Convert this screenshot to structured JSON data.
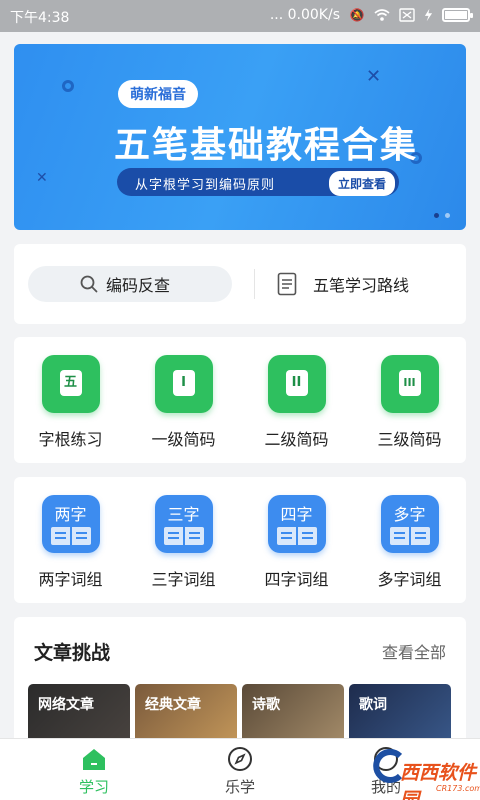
{
  "status_bar": {
    "time": "下午4:38",
    "network_speed": "... 0.00K/s",
    "icons": [
      "mute-icon",
      "wifi-icon",
      "sim-off-icon",
      "charging-icon"
    ],
    "battery_level": 1.0
  },
  "banner": {
    "brand": "萌新福音",
    "title": "五笔基础教程合集",
    "subtitle": "从字根学习到编码原则",
    "cta": "立即查看",
    "page_count": 2,
    "active_page": 1
  },
  "search": {
    "lookup_label": "编码反查",
    "route_label": "五笔学习路线"
  },
  "practice": {
    "items": [
      {
        "glyph": "五",
        "label": "字根练习"
      },
      {
        "glyph": "I",
        "label": "一级简码"
      },
      {
        "glyph": "II",
        "label": "二级简码"
      },
      {
        "glyph": "III",
        "label": "三级简码"
      }
    ]
  },
  "phrases": {
    "items": [
      {
        "glyph": "两字",
        "label": "两字词组"
      },
      {
        "glyph": "三字",
        "label": "三字词组"
      },
      {
        "glyph": "四字",
        "label": "四字词组"
      },
      {
        "glyph": "多字",
        "label": "多字词组"
      }
    ]
  },
  "articles": {
    "title": "文章挑战",
    "more": "查看全部",
    "items": [
      "网络文章",
      "经典文章",
      "诗歌",
      "歌词"
    ]
  },
  "tabbar": {
    "tabs": [
      {
        "label": "学习",
        "icon": "home-icon",
        "active": true
      },
      {
        "label": "乐学",
        "icon": "compass-icon",
        "active": false
      },
      {
        "label": "我的",
        "icon": "profile-icon",
        "active": false
      }
    ]
  },
  "watermark": {
    "text": "西西软件园",
    "url": "CR173.com"
  },
  "colors": {
    "accent": "#2ec05f",
    "blue_tile": "#3d8cef",
    "banner": "#2f8ff0",
    "status_bar": "#aeb0b3"
  }
}
